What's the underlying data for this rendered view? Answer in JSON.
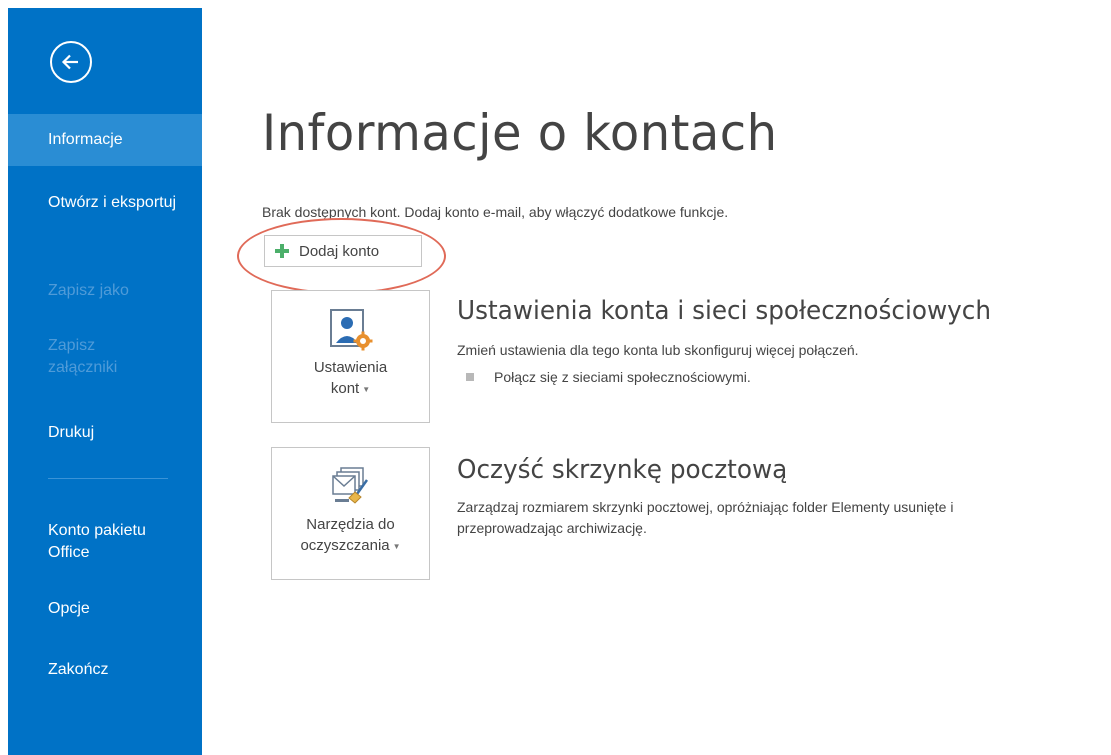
{
  "sidebar": {
    "items": [
      {
        "label": "Informacje",
        "active": true,
        "enabled": true
      },
      {
        "label": "Otwórz i eksportuj",
        "active": false,
        "enabled": true
      },
      {
        "label": "Zapisz jako",
        "active": false,
        "enabled": false
      },
      {
        "label": "Zapisz załączniki",
        "active": false,
        "enabled": false
      },
      {
        "label": "Drukuj",
        "active": false,
        "enabled": true
      },
      {
        "label": "Konto pakietu Office",
        "active": false,
        "enabled": true
      },
      {
        "label": "Opcje",
        "active": false,
        "enabled": true
      },
      {
        "label": "Zakończ",
        "active": false,
        "enabled": true
      }
    ],
    "back_icon": "back-arrow-icon"
  },
  "main": {
    "title": "Informacje o kontach",
    "notice": "Brak dostępnych kont. Dodaj konto e-mail, aby włączyć dodatkowe funkcje.",
    "add_account_label": "Dodaj konto",
    "sections": [
      {
        "tile_line1": "Ustawienia",
        "tile_line2": "kont",
        "title": "Ustawienia konta i sieci społecznościowych",
        "description": "Zmień ustawienia dla tego konta lub skonfiguruj więcej połączeń.",
        "bullet": "Połącz się z sieciami społecznościowymi."
      },
      {
        "tile_line1": "Narzędzia do",
        "tile_line2": "oczyszczania",
        "title": "Oczyść skrzynkę pocztową",
        "description_line1": "Zarządzaj rozmiarem skrzynki pocztowej, opróżniając folder Elementy usunięte i",
        "description_line2": "przeprowadzając archiwizację."
      }
    ]
  },
  "colors": {
    "sidebar_bg": "#0072c6",
    "sidebar_active": "#2a8dd4",
    "highlight": "#e06a58",
    "plus_green": "#4caf6a"
  }
}
